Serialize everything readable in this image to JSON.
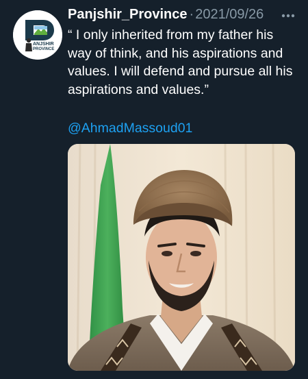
{
  "tweet": {
    "author": "Panjshir_Province",
    "separator": "·",
    "date": "2021/09/26",
    "text": "“ I only inherited from my father his way of think, and his aspirations and values. I will defend and pursue all his aspirations and values.”",
    "mention": "@AhmadMassoud01",
    "avatar_logo_text": "PANJSHIR PROVINCE",
    "more_icon": "more-dots-icon"
  },
  "colors": {
    "background": "#15202b",
    "text": "#ffffff",
    "muted": "#8899a6",
    "link": "#1da1f2"
  }
}
